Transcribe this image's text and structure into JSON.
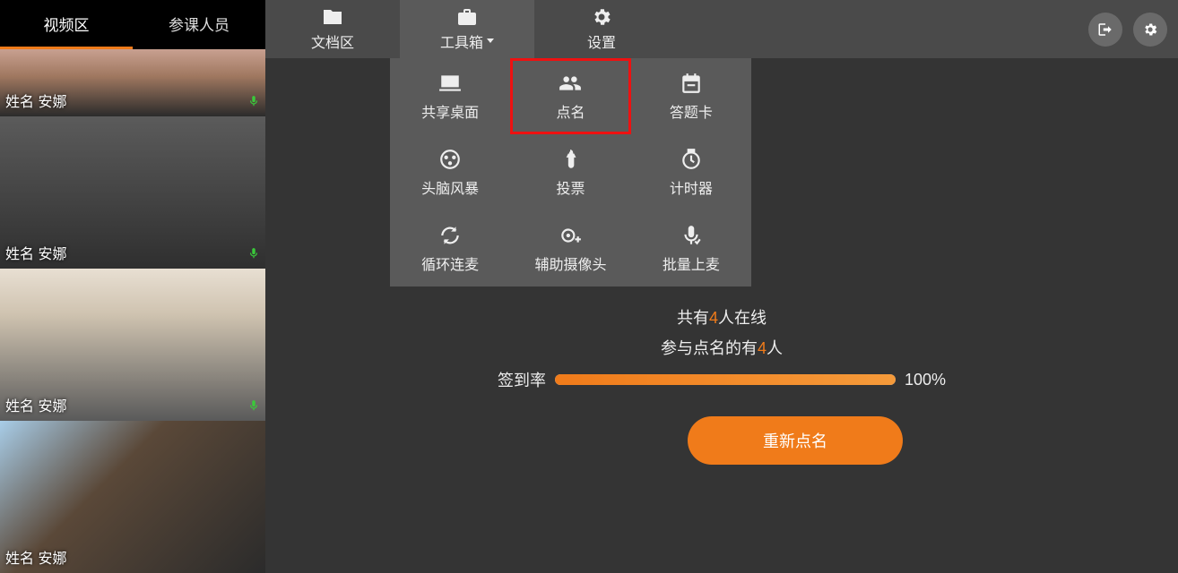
{
  "sidebar": {
    "tabs": {
      "video": "视频区",
      "participants": "参课人员"
    },
    "items": [
      {
        "name": "姓名 安娜"
      },
      {
        "name": "姓名 安娜"
      },
      {
        "name": "姓名 安娜"
      },
      {
        "name": "姓名 安娜"
      }
    ]
  },
  "topbar": {
    "doc_area": "文档区",
    "toolbox": "工具箱",
    "settings": "设置"
  },
  "tools": {
    "share_screen": "共享桌面",
    "roll_call": "点名",
    "answer_card": "答题卡",
    "brainstorm": "头脑风暴",
    "vote": "投票",
    "timer": "计时器",
    "cycle_mic": "循环连麦",
    "aux_camera": "辅助摄像头",
    "batch_mic": "批量上麦"
  },
  "rollcall": {
    "line1_prefix": "共有",
    "line1_count": "4",
    "line1_suffix": "人在线",
    "line2_prefix": "参与点名的有",
    "line2_count": "4",
    "line2_suffix": "人",
    "rate_label": "签到率",
    "rate_pct": "100%",
    "button": "重新点名"
  },
  "colors": {
    "accent": "#f07b1a"
  }
}
